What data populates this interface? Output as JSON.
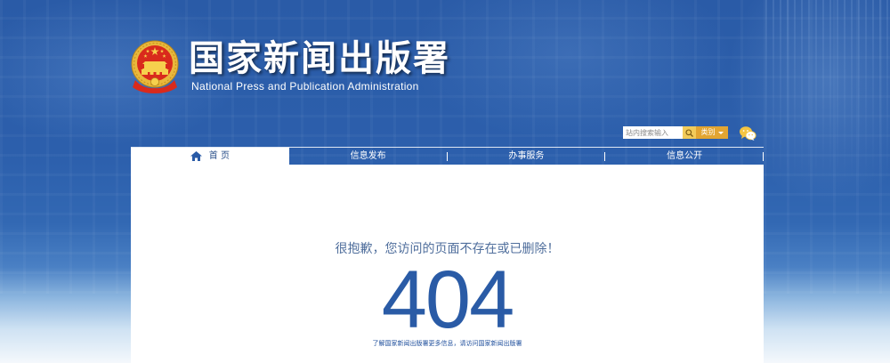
{
  "header": {
    "title": "国家新闻出版署",
    "subtitle_en": "National Press and Publication Administration"
  },
  "search": {
    "placeholder": "站内搜索输入",
    "category_label": "类别"
  },
  "nav": {
    "items": [
      {
        "label": "首 页",
        "icon": "home-icon",
        "active": true
      },
      {
        "label": "信息发布"
      },
      {
        "label": "办事服务"
      },
      {
        "label": "信息公开"
      }
    ]
  },
  "error": {
    "message": "很抱歉，您访问的页面不存在或已删除！",
    "code": "404",
    "hint_prefix": "了解国家新闻出版署更多信息，请访问",
    "hint_link": "国家新闻出版署"
  },
  "icons": {
    "logo": "national-emblem-icon",
    "search": "search-icon",
    "dropdown": "chevron-down-icon",
    "social": "wechat-icon",
    "home": "home-icon"
  },
  "colors": {
    "primary_blue": "#2a5ba7",
    "gold": "#e2a532",
    "error_text": "#4f6e9c",
    "code_blue": "#2a5ba6"
  }
}
